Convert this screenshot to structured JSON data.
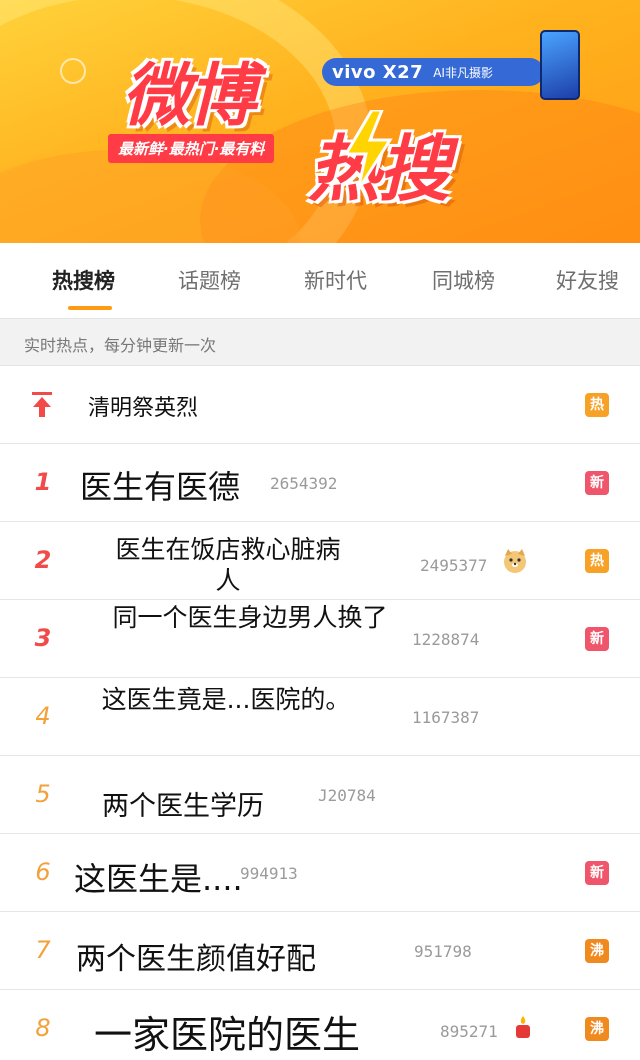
{
  "banner": {
    "title_main": "微博",
    "title_sub": "热搜",
    "slogan": "最新鲜·最热门·最有料",
    "sponsor_name": "vivo X27",
    "sponsor_sub": "AI非凡摄影"
  },
  "tabs": [
    {
      "label": "热搜榜",
      "active": true
    },
    {
      "label": "话题榜"
    },
    {
      "label": "新时代"
    },
    {
      "label": "同城榜"
    },
    {
      "label": "好友搜"
    }
  ],
  "notice": "实时热点，每分钟更新一次",
  "pinned": {
    "topic": "清明祭英烈",
    "badge": "热"
  },
  "items": [
    {
      "rank": "1",
      "topic": "医生有医德",
      "count": "2654392",
      "badge": "新"
    },
    {
      "rank": "2",
      "topic": "医生在饭店救心脏病人",
      "count": "2495377",
      "badge": "热",
      "emoji": "doge-emoji"
    },
    {
      "rank": "3",
      "topic": "同一个医生身边男人换了",
      "count": "1228874",
      "badge": "新"
    },
    {
      "rank": "4",
      "topic": "这医生竟是...医院的。",
      "count": "1167387",
      "badge": ""
    },
    {
      "rank": "5",
      "topic": "两个医生学历",
      "count": "J20784",
      "badge": ""
    },
    {
      "rank": "6",
      "topic": "这医生是....",
      "count": "994913",
      "badge": "新"
    },
    {
      "rank": "7",
      "topic": "两个医生颜值好配",
      "count": "951798",
      "badge": "沸"
    },
    {
      "rank": "8",
      "topic": "一家医院的医生",
      "count": "895271",
      "badge": "沸",
      "emoji": "candle-emoji"
    }
  ],
  "colors": {
    "accent": "#ff9a12",
    "rank_top": "#f24949",
    "rank_other": "#f2a23a",
    "badge_hot": "#f7a226",
    "badge_new": "#f0566b",
    "badge_boil": "#f08a1e"
  }
}
